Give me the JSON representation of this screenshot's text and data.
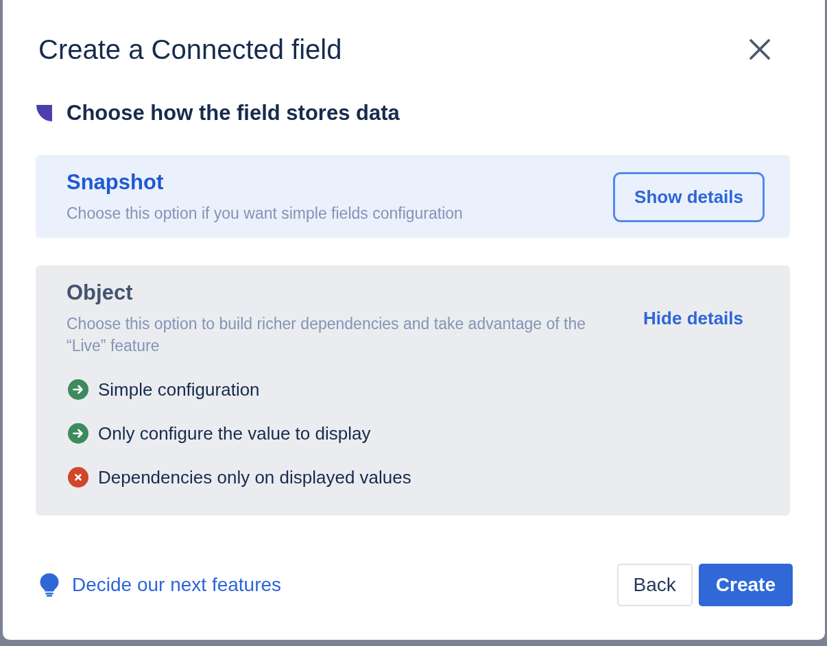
{
  "dialog": {
    "title": "Create a Connected field"
  },
  "section": {
    "heading": "Choose how the field stores data"
  },
  "options": [
    {
      "title": "Snapshot",
      "description": "Choose this option if you want simple fields configuration",
      "selected": true,
      "expanded": false,
      "details_toggle": {
        "label": "Show details",
        "focused": true
      }
    },
    {
      "title": "Object",
      "description": "Choose this option to build richer dependencies and take advantage of the “Live” feature",
      "selected": false,
      "expanded": true,
      "details_toggle": {
        "label": "Hide details",
        "focused": false
      },
      "features": [
        {
          "text": "Simple configuration",
          "kind": "pro"
        },
        {
          "text": "Only configure the value to display",
          "kind": "pro"
        },
        {
          "text": "Dependencies only on displayed values",
          "kind": "con"
        }
      ]
    }
  ],
  "footer": {
    "feedback_link": "Decide our next features",
    "buttons": [
      {
        "label": "Back",
        "kind": "secondary"
      },
      {
        "label": "Create",
        "kind": "primary"
      }
    ]
  }
}
